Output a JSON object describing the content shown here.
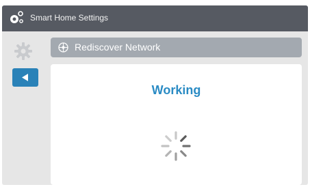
{
  "app": {
    "title": "Smart Home Settings",
    "icon": "smart-home-icon"
  },
  "sidebar": {
    "settings_icon": "gear-icon",
    "back_icon": "back-arrow-icon"
  },
  "section": {
    "title": "Rediscover Network",
    "icon": "network-icon"
  },
  "status": {
    "text": "Working",
    "indicator": "loading-spinner"
  },
  "colors": {
    "titlebar": "#565a62",
    "accent": "#2a82b8",
    "status_text": "#2a8bc4",
    "section_header": "#a3a9b0",
    "background": "#e6e6e6",
    "panel": "#ffffff"
  }
}
